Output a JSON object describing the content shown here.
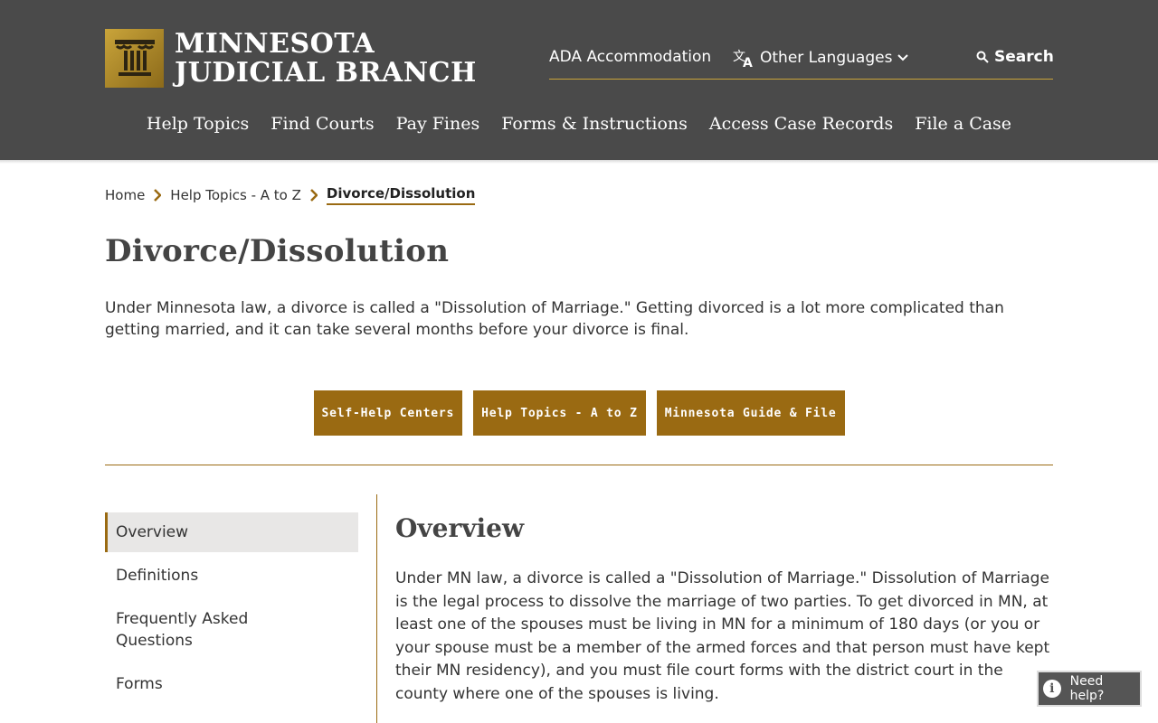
{
  "header": {
    "logo": {
      "line1": "MINNESOTA",
      "line2": "JUDICIAL BRANCH",
      "icon": "courthouse-pillar-icon",
      "gold": "#c9a43a"
    },
    "utility": {
      "ada": "ADA Accommodation",
      "languages": "Other Languages",
      "search": "Search"
    },
    "nav": [
      "Help Topics",
      "Find Courts",
      "Pay Fines",
      "Forms & Instructions",
      "Access Case Records",
      "File a Case"
    ],
    "bg_color": "#4a4a4a"
  },
  "breadcrumb": {
    "home": "Home",
    "parent": "Help Topics - A to Z",
    "current": "Divorce/Dissolution"
  },
  "page": {
    "title": "Divorce/Dissolution",
    "intro": "Under Minnesota law, a divorce is called a \"Dissolution of Marriage.\"  Getting divorced is a lot more complicated than getting married, and it can take several months before your divorce is final."
  },
  "buttons": {
    "self_help": "Self-Help Centers",
    "help_topics": "Help Topics - A to Z",
    "guide_file": "Minnesota Guide & File",
    "color": "#9a6a12"
  },
  "sidebar": {
    "items": [
      {
        "label": "Overview",
        "active": true
      },
      {
        "label": "Definitions",
        "active": false
      },
      {
        "label": "Frequently Asked Questions",
        "active": false
      },
      {
        "label": "Forms",
        "active": false
      }
    ]
  },
  "content": {
    "title": "Overview",
    "body": "Under MN law, a divorce is called a \"Dissolution of Marriage.\" Dissolution of Marriage is the legal process to dissolve the marriage of two parties. To get divorced in MN, at least one of the spouses must be living in MN for a minimum of 180 days (or you or your spouse must be a member of the armed forces and that person must have kept their MN residency), and you must file court forms with the district court in the county where one of the spouses is living."
  },
  "help_widget": {
    "label": "Need help?",
    "icon": "info-icon"
  }
}
